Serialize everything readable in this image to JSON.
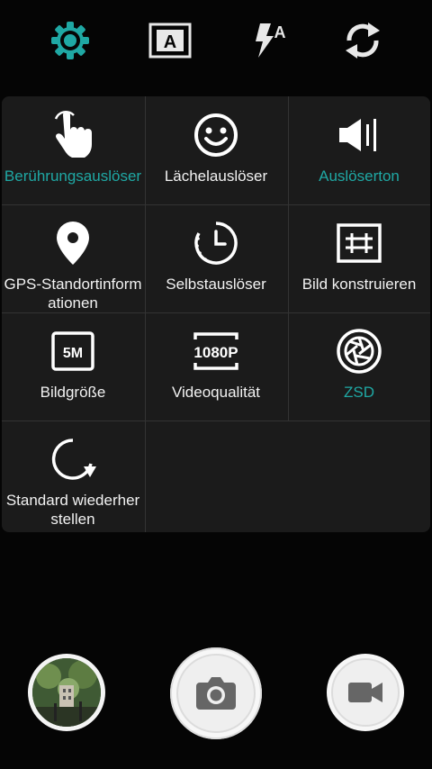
{
  "topbar": {
    "icons": [
      "settings-gear-icon",
      "auto-scene-icon",
      "flash-auto-icon",
      "switch-camera-icon"
    ],
    "accent_color": "#1fa8a4"
  },
  "settings": {
    "items": [
      {
        "label": "Berührungsauslöser",
        "icon": "touch-hand-icon",
        "active": true
      },
      {
        "label": "Lächelauslöser",
        "icon": "smile-face-icon",
        "active": false
      },
      {
        "label": "Auslöserton",
        "icon": "speaker-icon",
        "active": true
      },
      {
        "label": "GPS-Standortinformationen",
        "icon": "location-pin-icon",
        "active": false
      },
      {
        "label": "Selbstauslöser",
        "icon": "timer-clock-icon",
        "active": false
      },
      {
        "label": "Bild konstruieren",
        "icon": "grid-frame-icon",
        "active": false
      },
      {
        "label": "Bildgröße",
        "icon": "image-size-5m-icon",
        "icon_text": "5M",
        "active": false
      },
      {
        "label": "Videoqualität",
        "icon": "video-quality-1080p-icon",
        "icon_text": "1080P",
        "active": false
      },
      {
        "label": "ZSD",
        "icon": "aperture-icon",
        "active": true
      },
      {
        "label": "Standard wiederherstellen",
        "icon": "restore-icon",
        "active": false
      }
    ]
  },
  "bottom": {
    "icons": [
      "gallery-thumbnail",
      "camera-shutter-icon",
      "video-camera-icon"
    ]
  }
}
